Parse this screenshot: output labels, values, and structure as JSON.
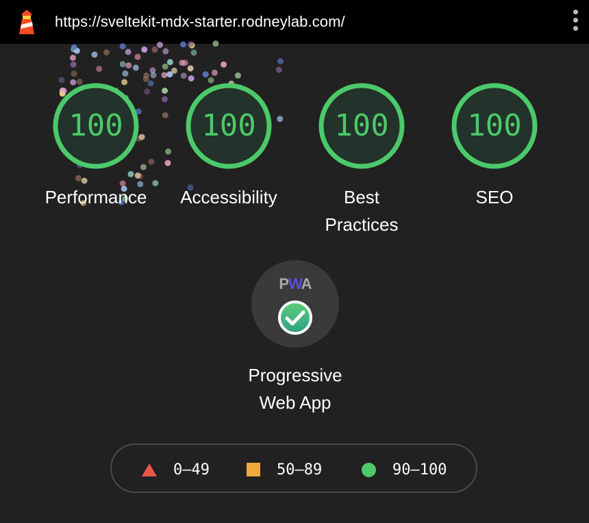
{
  "browser": {
    "url": "https://sveltekit-mdx-starter.rodneylab.com/"
  },
  "colors": {
    "pass": "#4cc96a",
    "average": "#f2a93b",
    "fail": "#e8574a",
    "background": "#212121"
  },
  "gauges": [
    {
      "score": "100",
      "label": "Performance"
    },
    {
      "score": "100",
      "label": "Accessibility"
    },
    {
      "score": "100",
      "label_line1": "Best",
      "label_line2": "Practices"
    },
    {
      "score": "100",
      "label": "SEO"
    }
  ],
  "pwa": {
    "badge_pw": "P",
    "badge_w": "W",
    "badge_a": "A",
    "label_line1": "Progressive",
    "label_line2": "Web App",
    "status_icon": "check-circle-icon"
  },
  "legend": {
    "fail": "0–49",
    "average": "50–89",
    "pass": "90–100"
  }
}
